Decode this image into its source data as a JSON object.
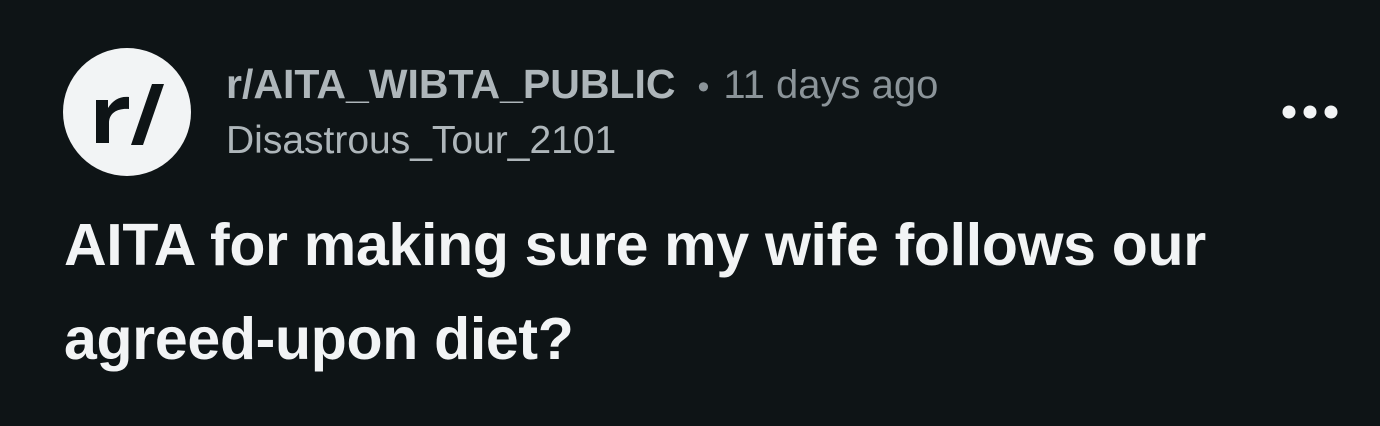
{
  "post": {
    "subreddit": "r/AITA_WIBTA_PUBLIC",
    "separator": "•",
    "timestamp": "11 days ago",
    "author": "Disastrous_Tour_2101",
    "title": "AITA for making sure my wife follows our agreed-upon diet?",
    "avatar_icon": "subreddit-r-slash-icon",
    "overflow_icon": "more-horizontal-icon"
  },
  "colors": {
    "background": "#0e1416",
    "avatar_bg": "#f2f4f5",
    "avatar_glyph": "#0e1416",
    "meta_text": "#aeb6ba",
    "muted_text": "#8b9499",
    "title_text": "#f2f4f5"
  }
}
